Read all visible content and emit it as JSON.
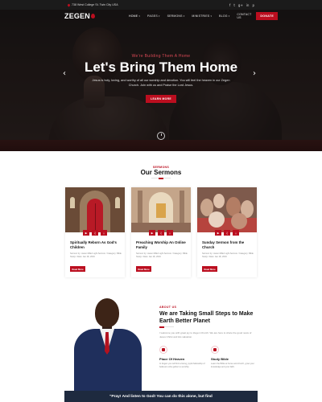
{
  "topbar": {
    "address": "738 West College St. Twin City USA",
    "social": [
      "f",
      "t",
      "g+",
      "in",
      "p"
    ]
  },
  "nav": {
    "logo": "ZEGEN",
    "items": [
      {
        "label": "HOME",
        "active": true,
        "has_dropdown": true
      },
      {
        "label": "PAGES",
        "active": false,
        "has_dropdown": true
      },
      {
        "label": "SERMONS",
        "active": false,
        "has_dropdown": true
      },
      {
        "label": "MINISTRIES",
        "active": false,
        "has_dropdown": true
      },
      {
        "label": "BLOG",
        "active": false,
        "has_dropdown": true
      },
      {
        "label": "CONTACT US",
        "active": false,
        "has_dropdown": false
      }
    ],
    "donate_label": "DONATE"
  },
  "hero": {
    "kicker": "We're Building Them A Home",
    "title": "Let's Bring Them Home",
    "desc": "Jesus is holy, loving, and worthy of all our worship and devotion. You will feel the heaven in our Zegen Church. Join with us and Praise the Lord Jesus.",
    "button": "LEARN MORE"
  },
  "sermons": {
    "kicker": "SERMONS",
    "title": "Our Sermons",
    "cards": [
      {
        "title": "Spiritually Reborn As God's Children",
        "meta": "Sermon by: Jason Miller Light Sermon / Category: Bible Study / Date: Jan 18, 2019",
        "button": "Read More"
      },
      {
        "title": "Preaching Worship An Online Family",
        "meta": "Sermon by: Jason Miller Light Sermon / Category: Bible Study / Date: Jan 18, 2019",
        "button": "Read More"
      },
      {
        "title": "Sunday Sermon from the Church",
        "meta": "Sermon by: Jason Miller Light Sermon / Category: Bible Study / Date: Jan 18, 2019",
        "button": "Read More"
      }
    ]
  },
  "about": {
    "kicker": "ABOUT US",
    "title": "We are Taking Small Steps to Make Earth Better Planet",
    "desc": "I welcome you with great joy to Zegen Church. We are here to share the good news of Jesus Christ and His salvation.",
    "features": [
      {
        "title": "Place Of Heaven",
        "desc": "In Zegen you will find a loving, joyful fellowship of believers who gather to worship."
      },
      {
        "title": "Study Bible",
        "desc": "Learn the Bible at home and church, grow your knowledge and your faith."
      }
    ],
    "quote": "\"Pray! And listen to God! You can do this alone, but find"
  },
  "colors": {
    "accent": "#bb0e1f",
    "dark": "#1b1b1b",
    "navy": "#1e2a3f"
  }
}
